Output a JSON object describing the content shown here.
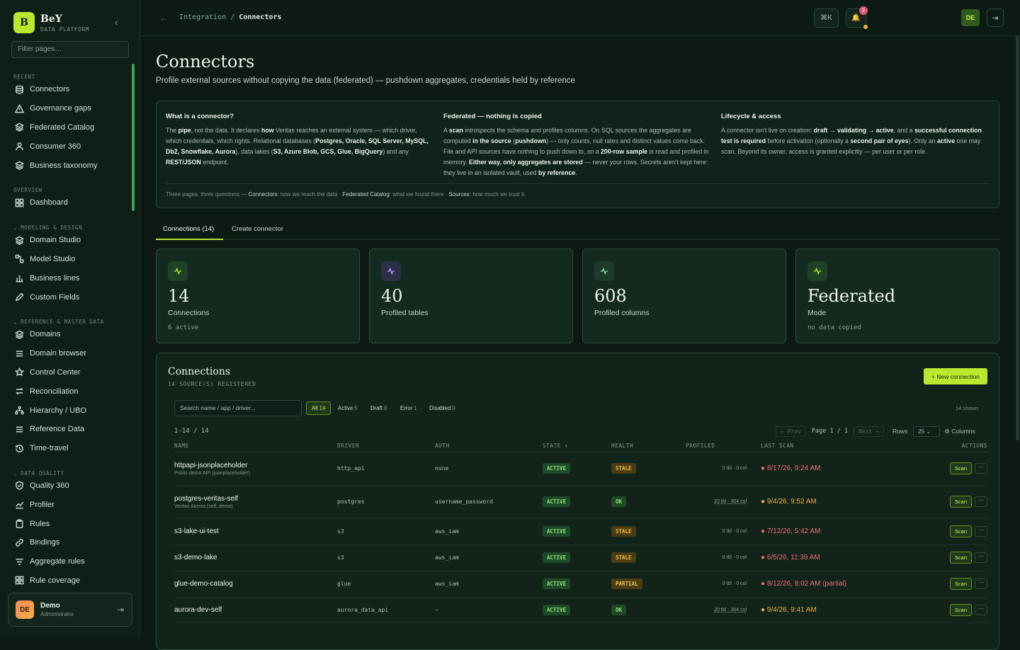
{
  "brand": {
    "logo": "B",
    "name": "BeY",
    "sub": "DATA PLATFORM",
    "collapse_icon": "chevron-left"
  },
  "sidebar": {
    "filter_placeholder": "Filter pages…",
    "sections": [
      {
        "label": "RECENT",
        "items": [
          {
            "label": "Connectors",
            "icon": "database"
          },
          {
            "label": "Governance gaps",
            "icon": "warning"
          },
          {
            "label": "Federated Catalog",
            "icon": "layers"
          },
          {
            "label": "Consumer 360",
            "icon": "user"
          },
          {
            "label": "Business taxonomy",
            "icon": "layers"
          }
        ]
      },
      {
        "label": "OVERVIEW",
        "items": [
          {
            "label": "Dashboard",
            "icon": "grid"
          }
        ]
      },
      {
        "label": "⌄ MODELING & DESIGN",
        "items": [
          {
            "label": "Domain Studio",
            "icon": "layers"
          },
          {
            "label": "Model Studio",
            "icon": "nodes"
          },
          {
            "label": "Business lines",
            "icon": "bar-chart"
          },
          {
            "label": "Custom Fields",
            "icon": "pencil"
          }
        ]
      },
      {
        "label": "⌄ REFERENCE & MASTER DATA",
        "items": [
          {
            "label": "Domains",
            "icon": "layers"
          },
          {
            "label": "Domain browser",
            "icon": "list"
          },
          {
            "label": "Control Center",
            "icon": "star"
          },
          {
            "label": "Reconciliation",
            "icon": "arrows"
          },
          {
            "label": "Hierarchy / UBO",
            "icon": "hierarchy"
          },
          {
            "label": "Reference Data",
            "icon": "list"
          },
          {
            "label": "Time-travel",
            "icon": "history"
          }
        ]
      },
      {
        "label": "⌄ DATA QUALITY",
        "items": [
          {
            "label": "Quality 360",
            "icon": "shield-check"
          },
          {
            "label": "Profiler",
            "icon": "line-chart"
          },
          {
            "label": "Rules",
            "icon": "clipboard"
          },
          {
            "label": "Bindings",
            "icon": "link"
          },
          {
            "label": "Aggregate rules",
            "icon": "filter"
          },
          {
            "label": "Rule coverage",
            "icon": "grid"
          }
        ]
      }
    ],
    "user": {
      "initials": "DE",
      "name": "Demo",
      "role": "Administrator"
    }
  },
  "topbar": {
    "breadcrumb_parent": "Integration",
    "breadcrumb_sep": "/",
    "breadcrumb_current": "Connectors",
    "shortcut": "⌘K",
    "notif_count": "2",
    "user_initials": "DE"
  },
  "page": {
    "title": "Connectors",
    "subtitle": "Profile external sources without copying the data (federated) — pushdown aggregates, credentials held by reference"
  },
  "info": {
    "foot_prefix": "Three pages, three questions —",
    "foot_1b": "Connectors",
    "foot_1": ": how we reach the data ·",
    "foot_2b": "Federated Catalog",
    "foot_2": ": what we found there ·",
    "foot_3b": "Sources",
    "foot_3": ": how much we trust it."
  },
  "tabs": {
    "connections": "Connections (14)",
    "create": "Create connector"
  },
  "stats": [
    {
      "value": "14",
      "label": "Connections",
      "meta": "6 active",
      "icon": "activity"
    },
    {
      "value": "40",
      "label": "Profiled tables",
      "meta": "",
      "icon": "activity"
    },
    {
      "value": "608",
      "label": "Profiled columns",
      "meta": "",
      "icon": "activity"
    },
    {
      "value": "Federated",
      "label": "Mode",
      "meta": "no data copied",
      "icon": "activity"
    }
  ],
  "panel": {
    "title": "Connections",
    "subtitle": "14 SOURCE(S) REGISTERED",
    "new_button": "+ New connection",
    "search_placeholder": "Search name / app / driver...",
    "filters": [
      {
        "label": "All",
        "count": "14"
      },
      {
        "label": "Active",
        "count": "6"
      },
      {
        "label": "Draft",
        "count": "8"
      },
      {
        "label": "Error",
        "count": "1"
      },
      {
        "label": "Disabled",
        "count": "0"
      }
    ],
    "shown": "14 shown",
    "range": "1-14 / 14",
    "prev": "← Prev",
    "page_label": "Page 1 / 1",
    "next": "Next →",
    "rows_label": "Rows",
    "rows_value": "25",
    "columns_label": "⚙ Columns",
    "columns": [
      "NAME",
      "DRIVER",
      "AUTH",
      "STATE ↑",
      "HEALTH",
      "PROFILED",
      "LAST SCAN",
      "ACTIONS"
    ],
    "scan_label": "Scan",
    "more_label": "···"
  },
  "rows": [
    {
      "name": "httpapi-jsonplaceholder",
      "desc": "Public demo API (jsonplaceholder)",
      "driver": "http_api",
      "auth": "none",
      "state": "ACTIVE",
      "health": "STALE",
      "profiled": "0 tbl · 0 col",
      "profiled_link": false,
      "last_scan": "● 8/17/26, 9:24 AM",
      "scan_tone": "red"
    },
    {
      "name": "postgres-veritas-self",
      "desc": "Veritas Aurora (self, demo)",
      "driver": "postgres",
      "auth": "username_password",
      "state": "ACTIVE",
      "health": "OK",
      "profiled": "20 tbl · 304 col",
      "profiled_link": true,
      "last_scan": "● 9/4/26, 9:52 AM",
      "scan_tone": "amber"
    },
    {
      "name": "s3-lake-ui-test",
      "desc": "",
      "driver": "s3",
      "auth": "aws_iam",
      "state": "ACTIVE",
      "health": "STALE",
      "profiled": "0 tbl · 0 col",
      "profiled_link": false,
      "last_scan": "● 7/12/26, 5:42 AM",
      "scan_tone": "red"
    },
    {
      "name": "s3-demo-lake",
      "desc": "",
      "driver": "s3",
      "auth": "aws_iam",
      "state": "ACTIVE",
      "health": "STALE",
      "profiled": "0 tbl · 0 col",
      "profiled_link": false,
      "last_scan": "● 6/5/26, 11:39 AM",
      "scan_tone": "red"
    },
    {
      "name": "glue-demo-catalog",
      "desc": "",
      "driver": "glue",
      "auth": "aws_iam",
      "state": "ACTIVE",
      "health": "PARTIAL",
      "profiled": "0 tbl · 0 col",
      "profiled_link": false,
      "last_scan": "● 8/12/26, 8:02 AM (partial)",
      "scan_tone": "red"
    },
    {
      "name": "aurora-dev-self",
      "desc": "",
      "driver": "aurora_data_api",
      "auth": "—",
      "state": "ACTIVE",
      "health": "OK",
      "profiled": "20 tbl · 304 col",
      "profiled_link": true,
      "last_scan": "● 9/4/26, 9:41 AM",
      "scan_tone": "amber"
    }
  ],
  "colors": {
    "accent": "#b9e82f",
    "bg": "#0d1a14",
    "stale": "#e8c24a",
    "ok": "#8ce07a",
    "scan_red": "#e86c7a",
    "scan_amber": "#e8b04a"
  }
}
